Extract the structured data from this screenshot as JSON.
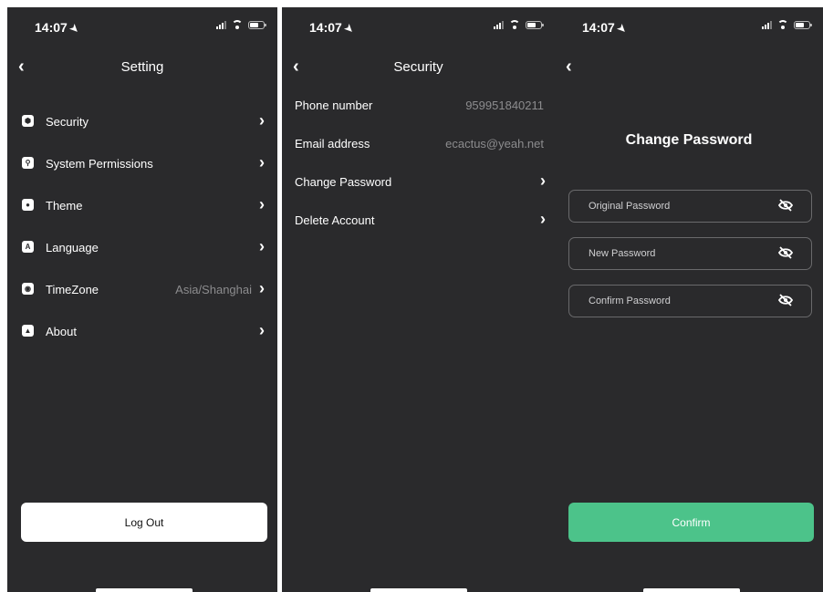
{
  "status_bar": {
    "time": "14:07"
  },
  "settings": {
    "title": "Setting",
    "items": [
      {
        "label": "Security",
        "icon": "shield-icon",
        "value": ""
      },
      {
        "label": "System Permissions",
        "icon": "key-icon",
        "value": ""
      },
      {
        "label": "Theme",
        "icon": "theme-icon",
        "value": ""
      },
      {
        "label": "Language",
        "icon": "language-icon",
        "value": ""
      },
      {
        "label": "TimeZone",
        "icon": "clock-icon",
        "value": "Asia/Shanghai"
      },
      {
        "label": "About",
        "icon": "about-icon",
        "value": ""
      }
    ],
    "logout_label": "Log Out"
  },
  "security": {
    "title": "Security",
    "phone_label": "Phone number",
    "phone_value": "959951840211",
    "email_label": "Email address",
    "email_value": "ecactus@yeah.net",
    "change_password_label": "Change Password",
    "delete_account_label": "Delete Account"
  },
  "change_password": {
    "title": "Change Password",
    "original_placeholder": "Original Password",
    "new_placeholder": "New Password",
    "confirm_placeholder": "Confirm Password",
    "confirm_button": "Confirm"
  },
  "colors": {
    "panel_bg": "#2a2a2c",
    "accent": "#4cc38a",
    "secondary_text": "#8c8c8e"
  }
}
